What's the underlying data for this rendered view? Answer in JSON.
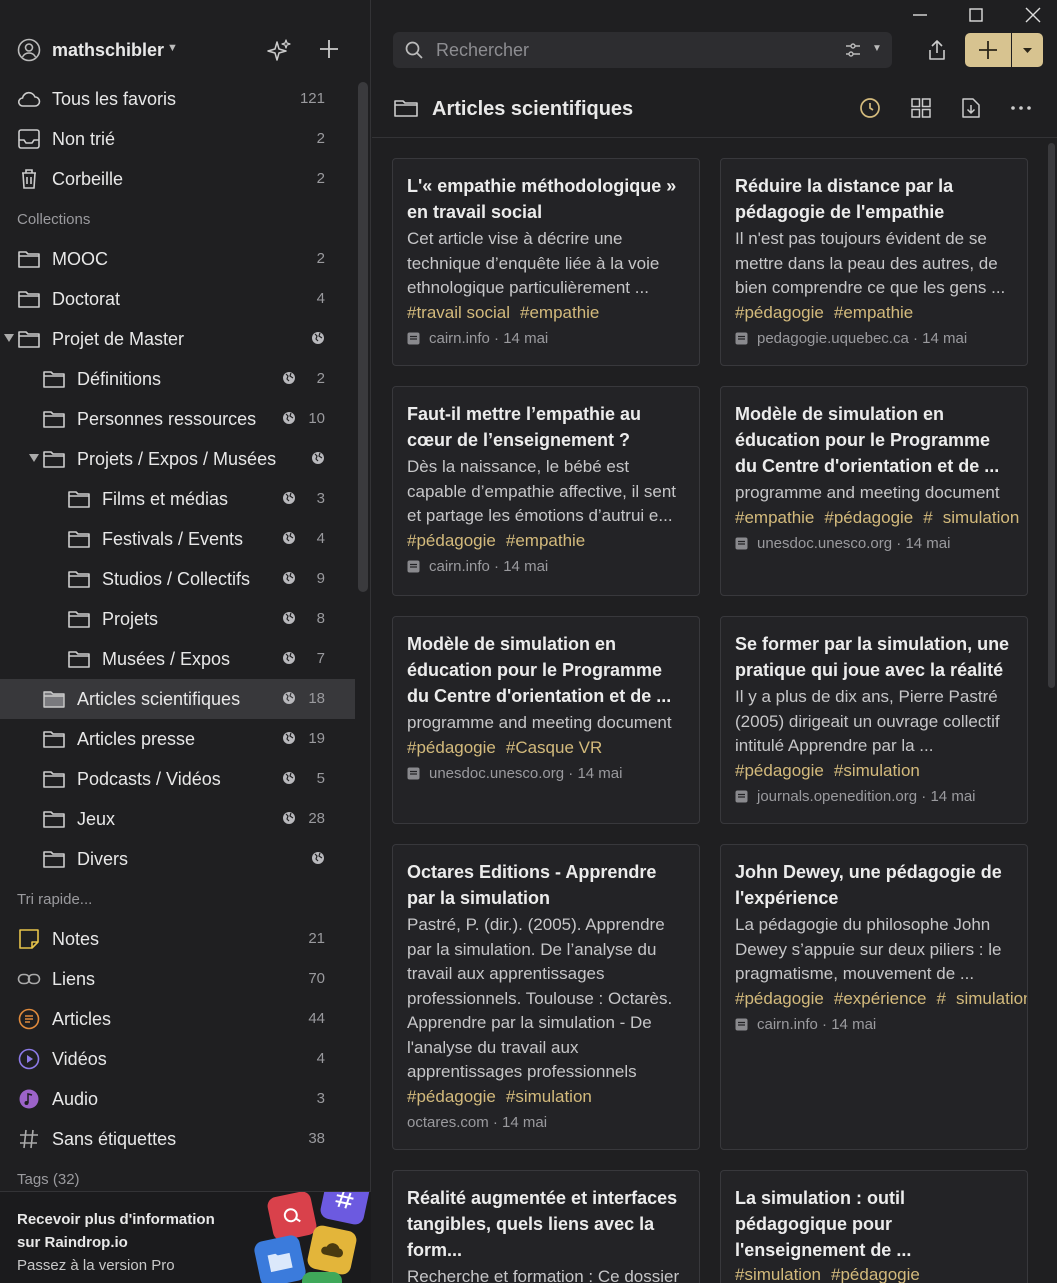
{
  "user": {
    "name": "mathschibler"
  },
  "sidebar": {
    "system": [
      {
        "label": "Tous les favoris",
        "count": "121",
        "icon": "cloud-icon"
      },
      {
        "label": "Non trié",
        "count": "2",
        "icon": "inbox-icon"
      },
      {
        "label": "Corbeille",
        "count": "2",
        "icon": "trash-icon"
      }
    ],
    "collections_header": "Collections",
    "collections": [
      {
        "label": "MOOC",
        "count": "2"
      },
      {
        "label": "Doctorat",
        "count": "4"
      },
      {
        "label": "Projet de Master",
        "count": ""
      },
      {
        "label": "Définitions",
        "count": "2"
      },
      {
        "label": "Personnes ressources",
        "count": "10"
      },
      {
        "label": "Projets / Expos / Musées",
        "count": ""
      },
      {
        "label": "Films et médias",
        "count": "3"
      },
      {
        "label": "Festivals / Events",
        "count": "4"
      },
      {
        "label": "Studios / Collectifs",
        "count": "9"
      },
      {
        "label": "Projets",
        "count": "8"
      },
      {
        "label": "Musées / Expos",
        "count": "7"
      },
      {
        "label": "Articles scientifiques",
        "count": "18"
      },
      {
        "label": "Articles presse",
        "count": "19"
      },
      {
        "label": "Podcasts / Vidéos",
        "count": "5"
      },
      {
        "label": "Jeux",
        "count": "28"
      },
      {
        "label": "Divers",
        "count": ""
      }
    ],
    "quick_header": "Tri rapide...",
    "quick": [
      {
        "label": "Notes",
        "count": "21"
      },
      {
        "label": "Liens",
        "count": "70"
      },
      {
        "label": "Articles",
        "count": "44"
      },
      {
        "label": "Vidéos",
        "count": "4"
      },
      {
        "label": "Audio",
        "count": "3"
      },
      {
        "label": "Sans étiquettes",
        "count": "38"
      }
    ],
    "tags_header": "Tags (32)",
    "promo": {
      "line1": "Recevoir plus d'information",
      "line2": "sur Raindrop.io",
      "line3": "Passez à la version Pro"
    }
  },
  "search": {
    "placeholder": "Rechercher"
  },
  "collection": {
    "title": "Articles scientifiques"
  },
  "colors": {
    "accent": "#d7c390",
    "tag": "#d3ba7c",
    "background": "#1f1f21",
    "card": "#232326"
  },
  "cards": [
    {
      "title": "L'« empathie méthodologique » en travail social",
      "desc": "Cet article vise à décrire une technique d’enquête liée à la voie ethnologique particulièrement ...",
      "tags": [
        "#travail social",
        "#empathie"
      ],
      "domain": "cairn.info",
      "date": "14 mai"
    },
    {
      "title": "Réduire la distance par la pédagogie de l'empathie",
      "desc": "Il n'est pas toujours évident de se mettre dans la peau des autres, de bien comprendre ce que les gens ...",
      "tags": [
        "#pédagogie",
        "#empathie"
      ],
      "domain": "pedagogie.uquebec.ca",
      "date": "14 mai"
    },
    {
      "title": "Faut-il mettre l’empathie au cœur de l’enseignement ?",
      "desc": "Dès la naissance, le bébé est capable d’empathie affective, il sent et partage les émotions d’autrui e...",
      "tags": [
        "#pédagogie",
        "#empathie"
      ],
      "domain": "cairn.info",
      "date": "14 mai"
    },
    {
      "title": "Modèle de simulation en éducation pour le Programme du Centre d'orientation et de ...",
      "desc": "programme and meeting document",
      "tags": [
        "#empathie",
        "#pédagogie",
        "#",
        "simulation"
      ],
      "domain": "unesdoc.unesco.org",
      "date": "14 mai"
    },
    {
      "title": "Modèle de simulation en éducation pour le Programme du Centre d'orientation et de ...",
      "desc": "programme and meeting document",
      "tags": [
        "#pédagogie",
        "#Casque VR"
      ],
      "domain": "unesdoc.unesco.org",
      "date": "14 mai"
    },
    {
      "title": "Se former par la simulation, une pratique qui joue avec la réalité",
      "desc": "Il y a plus de dix ans, Pierre Pastré (2005) dirigeait un ouvrage collectif intitulé Apprendre par la ...",
      "tags": [
        "#pédagogie",
        "#simulation"
      ],
      "domain": "journals.openedition.org",
      "date": "14 mai"
    },
    {
      "title": "Octares Editions - Apprendre par la simulation",
      "desc": "Pastré, P. (dir.). (2005). Apprendre par la simulation. De l’analyse du travail aux apprentissages professionnels. Toulouse : Octarès. Apprendre par la simulation - De l'analyse du travail aux apprentissages professionnels",
      "tags": [
        "#pédagogie",
        "#simulation"
      ],
      "domain": "octares.com",
      "date": "14 mai"
    },
    {
      "title": "John Dewey, une pédagogie de l'expérience",
      "desc": "La pédagogie du philosophe John Dewey s’appuie sur deux piliers : le pragmatisme, mouvement de ...",
      "tags": [
        "#pédagogie",
        "#expérience",
        "#",
        "simulation"
      ],
      "domain": "cairn.info",
      "date": "14 mai"
    },
    {
      "title": "Réalité augmentée et interfaces tangibles, quels liens avec la form...",
      "desc": "Recherche et formation : Ce dossier",
      "tags": [],
      "domain": "",
      "date": ""
    },
    {
      "title": "La simulation : outil pédagogique pour l'enseignement de ...",
      "desc": "",
      "tags": [
        "#simulation",
        "#pédagogie"
      ],
      "domain": "",
      "date": ""
    }
  ]
}
